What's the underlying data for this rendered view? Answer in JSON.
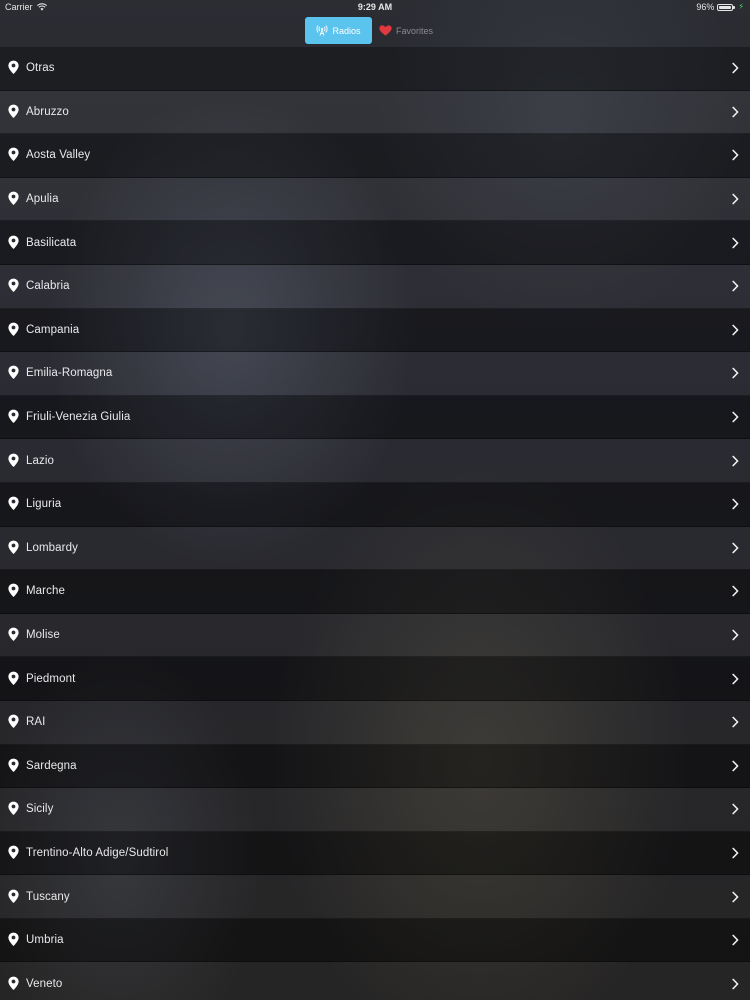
{
  "status_bar": {
    "carrier": "Carrier",
    "time": "9:29 AM",
    "battery_text": "96%",
    "battery_level": 0.96,
    "icons": [
      "wifi-icon",
      "battery-icon",
      "charging-icon"
    ]
  },
  "tabs": {
    "radios": {
      "label": "Radios",
      "icon": "radio-antenna-icon",
      "selected": true
    },
    "favorites": {
      "label": "Favorites",
      "icon": "heart-icon",
      "selected": false
    }
  },
  "colors": {
    "accent": "#5bc4ee",
    "heart": "#e0393f",
    "text": "#e9e9ec"
  },
  "regions": [
    "Otras",
    "Abruzzo",
    "Aosta Valley",
    "Apulia",
    "Basilicata",
    "Calabria",
    "Campania",
    "Emilia-Romagna",
    "Friuli-Venezia Giulia",
    "Lazio",
    "Liguria",
    "Lombardy",
    "Marche",
    "Molise",
    "Piedmont",
    "RAI",
    "Sardegna",
    "Sicily",
    "Trentino-Alto Adige/Sudtirol",
    "Tuscany",
    "Umbria",
    "Veneto"
  ],
  "row_icons": {
    "leading": "map-pin-icon",
    "trailing": "chevron-right-icon"
  }
}
